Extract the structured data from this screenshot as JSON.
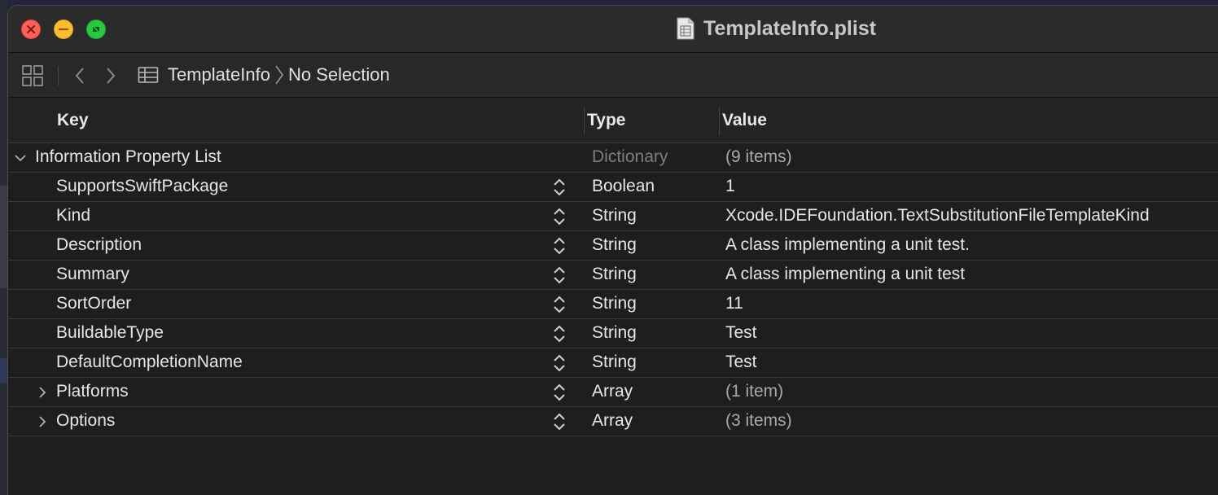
{
  "window": {
    "title": "TemplateInfo.plist",
    "title_icon": "document-icon"
  },
  "toolbar": {
    "grid_icon": "grid-icon",
    "back_icon": "chevron-left-icon",
    "forward_icon": "chevron-right-icon",
    "breadcrumb_root": "TemplateInfo",
    "breadcrumb_current": "No Selection"
  },
  "table": {
    "headers": {
      "key": "Key",
      "type": "Type",
      "value": "Value"
    },
    "root": {
      "key": "Information Property List",
      "type": "Dictionary",
      "value": "(9 items)"
    },
    "rows": [
      {
        "key": "SupportsSwiftPackage",
        "type": "Boolean",
        "value": "1"
      },
      {
        "key": "Kind",
        "type": "String",
        "value": "Xcode.IDEFoundation.TextSubstitutionFileTemplateKind"
      },
      {
        "key": "Description",
        "type": "String",
        "value": "A class implementing a unit test."
      },
      {
        "key": "Summary",
        "type": "String",
        "value": "A class implementing a unit test"
      },
      {
        "key": "SortOrder",
        "type": "String",
        "value": "11"
      },
      {
        "key": "BuildableType",
        "type": "String",
        "value": "Test"
      },
      {
        "key": "DefaultCompletionName",
        "type": "String",
        "value": "Test"
      },
      {
        "key": "Platforms",
        "type": "Array",
        "value": "(1 item)"
      },
      {
        "key": "Options",
        "type": "Array",
        "value": "(3 items)"
      }
    ]
  },
  "colors": {
    "close": "#ff5f57",
    "minimize": "#febc2e",
    "zoom": "#28c840"
  }
}
